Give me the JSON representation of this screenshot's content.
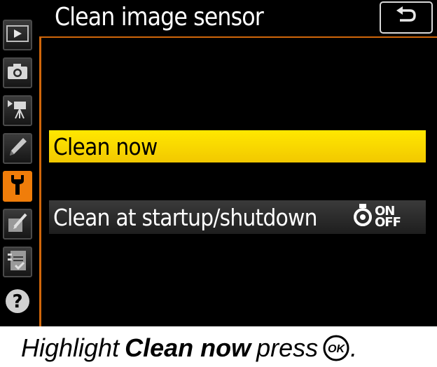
{
  "screen": {
    "title": "Clean image sensor",
    "back_button_icon": "return-icon"
  },
  "sidebar": {
    "items": [
      {
        "name": "playback",
        "icon": "playback-icon",
        "active": false
      },
      {
        "name": "photo-shooting",
        "icon": "camera-icon",
        "active": false
      },
      {
        "name": "movie-shooting",
        "icon": "movie-camera-icon",
        "active": false
      },
      {
        "name": "custom-settings",
        "icon": "pencil-icon",
        "active": false
      },
      {
        "name": "setup",
        "icon": "wrench-icon",
        "active": true
      },
      {
        "name": "retouch",
        "icon": "retouch-icon",
        "active": false
      },
      {
        "name": "my-menu",
        "icon": "my-menu-icon",
        "active": false
      },
      {
        "name": "help",
        "icon": "help-icon",
        "active": false
      }
    ]
  },
  "menu": {
    "items": [
      {
        "label": "Clean now",
        "selected": true
      },
      {
        "label": "Clean at startup/shutdown",
        "selected": false,
        "setting_on": "ON",
        "setting_off": "OFF"
      }
    ]
  },
  "caption": {
    "prefix": "Highlight",
    "emphasis": "Clean now",
    "suffix": "press",
    "ok_text": "OK"
  },
  "colors": {
    "accent": "#f07d0a",
    "highlight": "#ffe100",
    "background": "#000000"
  }
}
